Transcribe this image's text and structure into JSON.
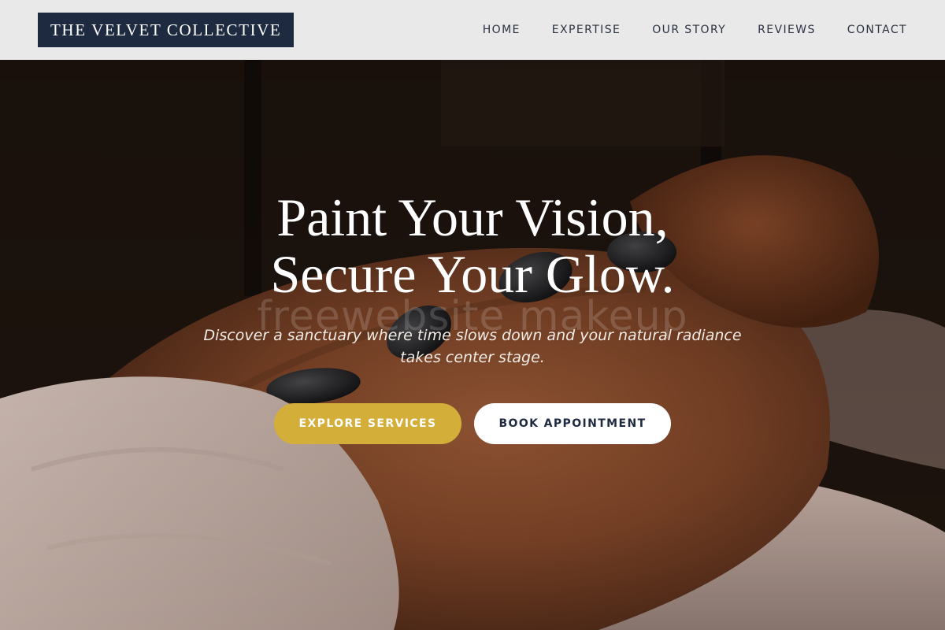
{
  "brand": {
    "name": "THE VELVET COLLECTIVE"
  },
  "nav": {
    "items": [
      {
        "label": "HOME"
      },
      {
        "label": "EXPERTISE"
      },
      {
        "label": "OUR STORY"
      },
      {
        "label": "REVIEWS"
      },
      {
        "label": "CONTACT"
      }
    ]
  },
  "hero": {
    "headline_line1": "Paint Your Vision,",
    "headline_line2": "Secure Your Glow.",
    "subtext_line1": "Discover a sanctuary where time slows down and your natural radiance",
    "subtext_line2": "takes center stage.",
    "watermark": "freewebsite makeup",
    "primary_button": "EXPLORE SERVICES",
    "secondary_button": "BOOK APPOINTMENT",
    "image_subject": "hot-stone-massage-photo"
  },
  "colors": {
    "header_bg": "#e9e9ea",
    "logo_bg": "#1e2a40",
    "accent_gold": "#d3ae38",
    "nav_text": "#2b3240"
  }
}
